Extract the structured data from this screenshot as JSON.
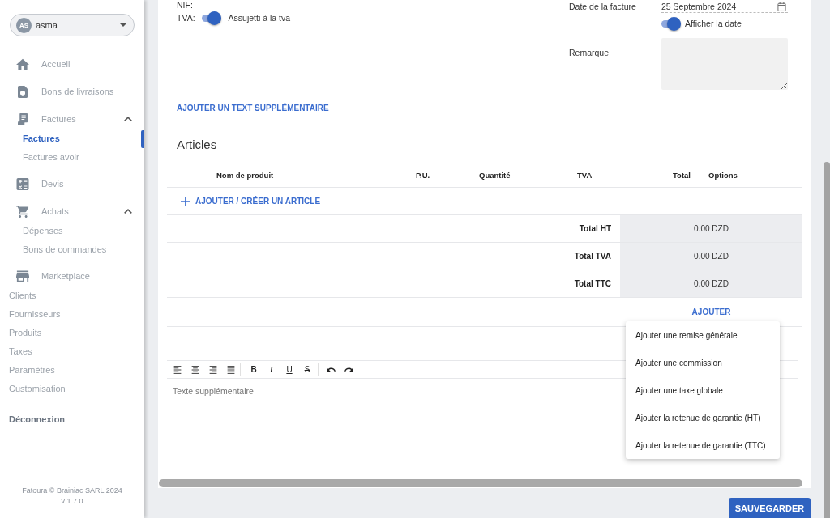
{
  "sidebar": {
    "account": {
      "initials": "AS",
      "name": "asma"
    },
    "nav": [
      {
        "kind": "icon",
        "label": "Accueil",
        "selected": false
      },
      {
        "kind": "icon",
        "label": "Bons de livraisons",
        "selected": false
      },
      {
        "kind": "icon",
        "label": "Factures",
        "selected": false,
        "expanded": true,
        "children": [
          {
            "label": "Factures",
            "selected": true
          },
          {
            "label": "Factures avoir",
            "selected": false
          }
        ]
      },
      {
        "kind": "icon",
        "label": "Devis",
        "selected": false
      },
      {
        "kind": "icon",
        "label": "Achats",
        "selected": false,
        "expanded": true,
        "children": [
          {
            "label": "Dépenses",
            "selected": false
          },
          {
            "label": "Bons de commandes",
            "selected": false
          }
        ]
      },
      {
        "kind": "icon",
        "label": "Marketplace",
        "selected": false
      },
      {
        "kind": "plain",
        "label": "Clients",
        "selected": false
      },
      {
        "kind": "plain",
        "label": "Fournisseurs",
        "selected": false
      },
      {
        "kind": "plain",
        "label": "Produits",
        "selected": false
      },
      {
        "kind": "plain",
        "label": "Taxes",
        "selected": false
      },
      {
        "kind": "plain",
        "label": "Paramètres",
        "selected": false
      },
      {
        "kind": "plain",
        "label": "Customisation",
        "selected": false
      }
    ],
    "logout": "Déconnexion",
    "footer": [
      "Fatoura © Brainiac SARL 2024",
      "v 1.7.0"
    ]
  },
  "invoice": {
    "nif_label": "NIF:",
    "tva": {
      "label": "TVA:",
      "on": true,
      "text": "Assujetti à la tva"
    },
    "date": {
      "label": "Date de la facture",
      "value": "25 Septembre 2024"
    },
    "show_date": {
      "on": true,
      "label": "Afficher la date"
    },
    "remark": {
      "label": "Remarque"
    },
    "add_text_link": "AJOUTER UN TEXT SUPPLÉMENTAIRE"
  },
  "articles": {
    "title": "Articles",
    "columns": [
      "Nom de produit",
      "P.U.",
      "Quantité",
      "TVA",
      "Total",
      "Options"
    ],
    "add_article": "AJOUTER / CRÉER UN ARTICLE",
    "totals": [
      {
        "label": "Total HT",
        "value": "0.00 DZD"
      },
      {
        "label": "Total TVA",
        "value": "0.00 DZD"
      },
      {
        "label": "Total TTC",
        "value": "0.00 DZD"
      }
    ],
    "add_button": "AJOUTER"
  },
  "add_menu": {
    "items": [
      "Ajouter une remise générale",
      "Ajouter une commission",
      "Ajouter une taxe globale",
      "Ajouter la retenue de garantie (HT)",
      "Ajouter la retenue de garantie (TTC)"
    ]
  },
  "editor": {
    "format_buttons": [
      {
        "kind": "bold",
        "label": "B"
      },
      {
        "kind": "italic",
        "label": "I"
      },
      {
        "kind": "underline",
        "label": "U"
      },
      {
        "kind": "strike",
        "label": "S"
      }
    ],
    "placeholder": "Texte supplémentaire"
  },
  "save_button": "SAUVEGARDER"
}
